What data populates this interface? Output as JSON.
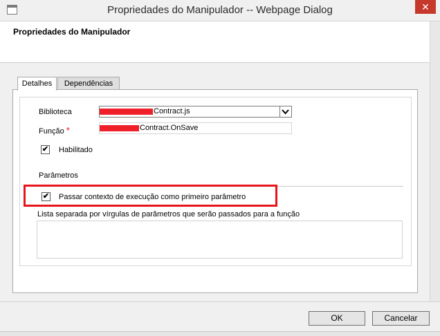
{
  "window": {
    "title": "Propriedades do Manipulador -- Webpage Dialog",
    "close_glyph": "✕"
  },
  "header": {
    "title": "Propriedades do Manipulador"
  },
  "tabs": [
    {
      "label": "Detalhes",
      "active": true
    },
    {
      "label": "Dependências",
      "active": false
    }
  ],
  "form": {
    "library_label": "Biblioteca",
    "library_value": "Contract.js",
    "function_label": "Função",
    "required_mark": "*",
    "function_value": "Contract.OnSave",
    "enabled_label": "Habilitado",
    "enabled_checked": true,
    "params_section_label": "Parâmetros",
    "pass_context_label": "Passar contexto de execução como primeiro parâmetro",
    "pass_context_checked": true,
    "params_list_label": "Lista separada por vírgulas de parâmetros que serão passados para a função",
    "params_list_value": "",
    "check_glyph": "✔",
    "dropdown_glyph": "▼"
  },
  "buttons": {
    "ok": "OK",
    "cancel": "Cancelar"
  },
  "colors": {
    "highlight": "#e8141b",
    "redaction": "#f0202a",
    "close": "#c7382c"
  }
}
